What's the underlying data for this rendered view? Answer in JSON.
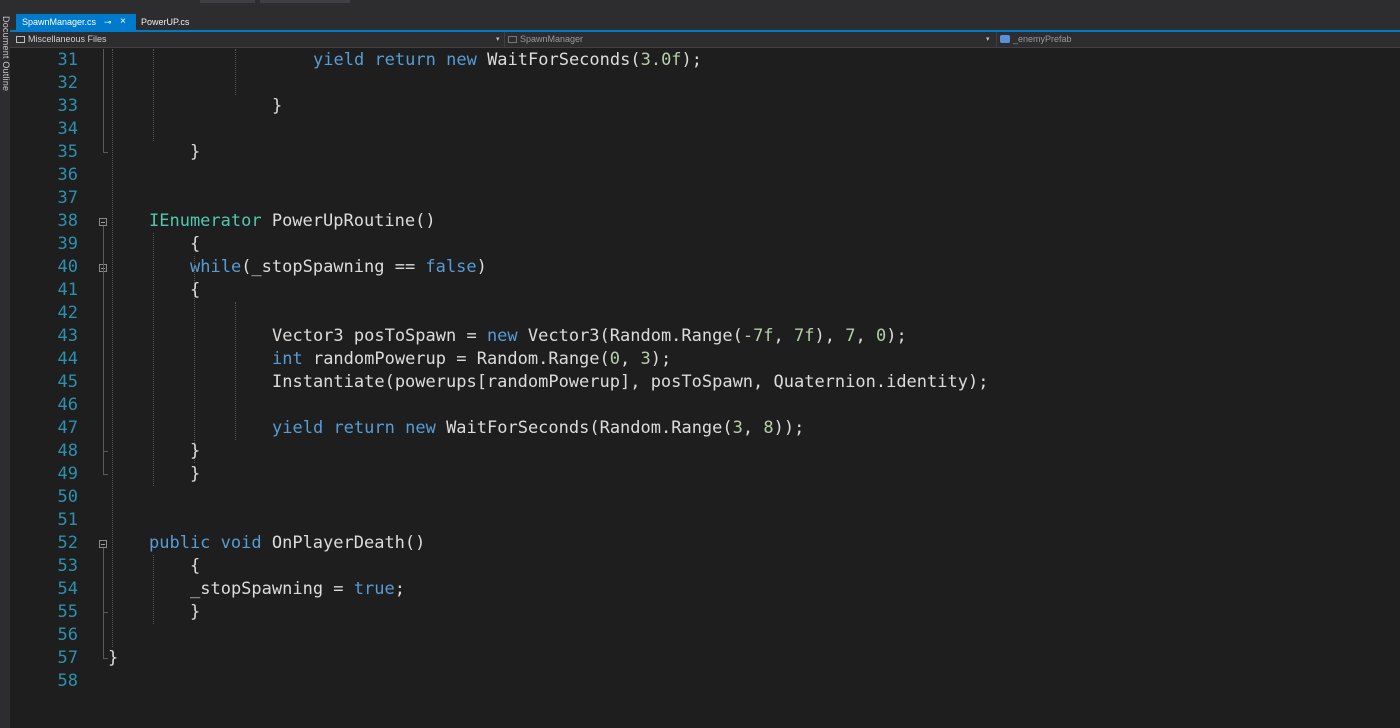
{
  "window": {
    "side_panel_label": "Document Outline"
  },
  "tabs": [
    {
      "label": "SpawnManager.cs",
      "active": true,
      "pin_icon": "pin-icon",
      "close_icon": "close-icon",
      "pin_glyph": "⊸",
      "close_glyph": "×"
    },
    {
      "label": "PowerUP.cs",
      "active": false
    }
  ],
  "navigation": {
    "file_scope": "Miscellaneous Files",
    "class_scope": "SpawnManager",
    "member_scope": "_enemyPrefab",
    "caret": "▾"
  },
  "editor": {
    "theme": {
      "background": "#1e1e1e",
      "line_number": "#2b91af",
      "keyword": "#569cd6",
      "type": "#4ec9b0",
      "number": "#b5cea8",
      "default": "#dcdcdc",
      "accent": "#007acc"
    },
    "lines": [
      {
        "number": "31",
        "tokens": [
          {
            "c": "k",
            "t": "yield"
          },
          {
            "c": "d",
            "t": " "
          },
          {
            "c": "k",
            "t": "return"
          },
          {
            "c": "d",
            "t": " "
          },
          {
            "c": "k",
            "t": "new"
          },
          {
            "c": "d",
            "t": " WaitForSeconds("
          },
          {
            "c": "n",
            "t": "3.0f"
          },
          {
            "c": "d",
            "t": ");"
          }
        ]
      },
      {
        "number": "32",
        "tokens": []
      },
      {
        "number": "33",
        "tokens": [
          {
            "c": "d",
            "t": "}"
          }
        ]
      },
      {
        "number": "34",
        "tokens": []
      },
      {
        "number": "35",
        "tokens": [
          {
            "c": "d",
            "t": "}"
          }
        ]
      },
      {
        "number": "36",
        "tokens": []
      },
      {
        "number": "37",
        "tokens": []
      },
      {
        "number": "38",
        "tokens": [
          {
            "c": "t",
            "t": "IEnumerator"
          },
          {
            "c": "d",
            "t": " PowerUpRoutine()"
          }
        ]
      },
      {
        "number": "39",
        "tokens": [
          {
            "c": "d",
            "t": "{"
          }
        ]
      },
      {
        "number": "40",
        "tokens": [
          {
            "c": "k",
            "t": "while"
          },
          {
            "c": "d",
            "t": "(_stopSpawning == "
          },
          {
            "c": "k",
            "t": "false"
          },
          {
            "c": "d",
            "t": ")"
          }
        ]
      },
      {
        "number": "41",
        "tokens": [
          {
            "c": "d",
            "t": "{"
          }
        ]
      },
      {
        "number": "42",
        "tokens": []
      },
      {
        "number": "43",
        "tokens": [
          {
            "c": "d",
            "t": "Vector3 posToSpawn = "
          },
          {
            "c": "k",
            "t": "new"
          },
          {
            "c": "d",
            "t": " Vector3(Random.Range("
          },
          {
            "c": "n",
            "t": "-7f"
          },
          {
            "c": "d",
            "t": ", "
          },
          {
            "c": "n",
            "t": "7f"
          },
          {
            "c": "d",
            "t": "), "
          },
          {
            "c": "n",
            "t": "7"
          },
          {
            "c": "d",
            "t": ", "
          },
          {
            "c": "n",
            "t": "0"
          },
          {
            "c": "d",
            "t": ");"
          }
        ]
      },
      {
        "number": "44",
        "tokens": [
          {
            "c": "k",
            "t": "int"
          },
          {
            "c": "d",
            "t": " randomPowerup = Random.Range("
          },
          {
            "c": "n",
            "t": "0"
          },
          {
            "c": "d",
            "t": ", "
          },
          {
            "c": "n",
            "t": "3"
          },
          {
            "c": "d",
            "t": ");"
          }
        ]
      },
      {
        "number": "45",
        "tokens": [
          {
            "c": "d",
            "t": "Instantiate(powerups[randomPowerup], posToSpawn, Quaternion.identity);"
          }
        ]
      },
      {
        "number": "46",
        "tokens": []
      },
      {
        "number": "47",
        "tokens": [
          {
            "c": "k",
            "t": "yield"
          },
          {
            "c": "d",
            "t": " "
          },
          {
            "c": "k",
            "t": "return"
          },
          {
            "c": "d",
            "t": " "
          },
          {
            "c": "k",
            "t": "new"
          },
          {
            "c": "d",
            "t": " WaitForSeconds(Random.Range("
          },
          {
            "c": "n",
            "t": "3"
          },
          {
            "c": "d",
            "t": ", "
          },
          {
            "c": "n",
            "t": "8"
          },
          {
            "c": "d",
            "t": "));"
          }
        ]
      },
      {
        "number": "48",
        "tokens": [
          {
            "c": "d",
            "t": "}"
          }
        ]
      },
      {
        "number": "49",
        "tokens": [
          {
            "c": "d",
            "t": "}"
          }
        ]
      },
      {
        "number": "50",
        "tokens": []
      },
      {
        "number": "51",
        "tokens": []
      },
      {
        "number": "52",
        "tokens": [
          {
            "c": "k",
            "t": "public"
          },
          {
            "c": "d",
            "t": " "
          },
          {
            "c": "k",
            "t": "void"
          },
          {
            "c": "d",
            "t": " OnPlayerDeath()"
          }
        ]
      },
      {
        "number": "53",
        "tokens": [
          {
            "c": "d",
            "t": "{"
          }
        ]
      },
      {
        "number": "54",
        "tokens": [
          {
            "c": "d",
            "t": "_stopSpawning = "
          },
          {
            "c": "k",
            "t": "true"
          },
          {
            "c": "d",
            "t": ";"
          }
        ]
      },
      {
        "number": "55",
        "tokens": [
          {
            "c": "d",
            "t": "}"
          }
        ]
      },
      {
        "number": "56",
        "tokens": []
      },
      {
        "number": "57",
        "tokens": [
          {
            "c": "d",
            "t": "}"
          }
        ]
      },
      {
        "number": "58",
        "tokens": []
      }
    ]
  }
}
